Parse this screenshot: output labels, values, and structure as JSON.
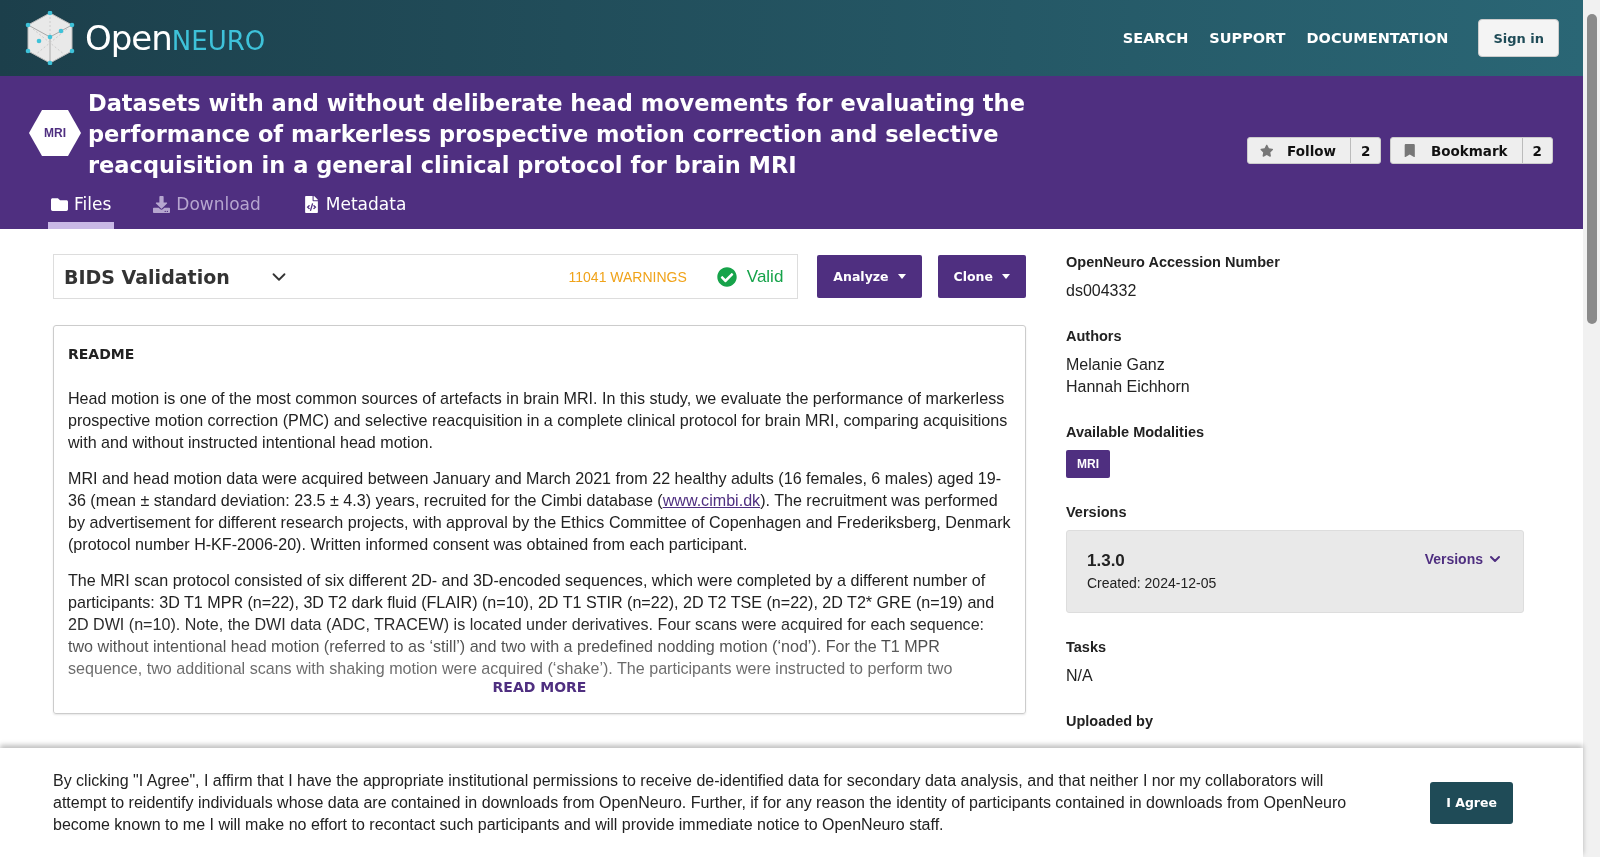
{
  "header": {
    "logo": {
      "open": "Open",
      "neuro": "NEURO"
    },
    "nav": [
      "SEARCH",
      "SUPPORT",
      "DOCUMENTATION"
    ],
    "sign_in": "Sign in"
  },
  "dataset": {
    "modality_badge": "MRI",
    "title": "Datasets with and without deliberate head movements for evaluating the performance of markerless prospective motion correction and selective reacquisition in a general clinical protocol for brain MRI",
    "actions": [
      {
        "kind": "follow",
        "label": "Follow",
        "count": "2"
      },
      {
        "kind": "bookmark",
        "label": "Bookmark",
        "count": "2"
      }
    ]
  },
  "tabs": [
    {
      "kind": "folder",
      "label": "Files",
      "selected": true,
      "disabled": false
    },
    {
      "kind": "download",
      "label": "Download",
      "selected": false,
      "disabled": true
    },
    {
      "kind": "file",
      "label": "Metadata",
      "selected": false,
      "disabled": false
    }
  ],
  "validation": {
    "title": "BIDS Validation",
    "warnings": "11041 WARNINGS",
    "status": "Valid"
  },
  "buttons": [
    "Analyze",
    "Clone"
  ],
  "readme": {
    "heading": "README",
    "paragraphs": [
      "Head motion is one of the most common sources of artefacts in brain MRI. In this study, we evaluate the performance of markerless prospective motion correction (PMC) and selective reacquisition in a complete clinical protocol for brain MRI, comparing acquisitions with and without instructed intentional head motion.",
      {
        "before": "MRI and head motion data were acquired between January and March 2021 from 22 healthy adults (16 females, 6 males) aged 19-36 (mean ± standard deviation: 23.5 ± 4.3) years, recruited for the Cimbi database (",
        "link": "www.cimbi.dk",
        "after": "). The recruitment was performed by advertisement for different research projects, with approval by the Ethics Committee of Copenhagen and Frederiksberg, Denmark (protocol number H-KF-2006-20). Written informed consent was obtained from each participant."
      },
      "The MRI scan protocol consisted of six different 2D- and 3D-encoded sequences, which were completed by a different number of participants: 3D T1 MPR (n=22), 3D T2 dark fluid (FLAIR) (n=10), 2D T1 STIR (n=22), 2D T2 TSE (n=22), 2D T2* GRE (n=19) and 2D DWI (n=10). Note, the DWI data (ADC, TRACEW) is located under derivatives. Four scans were acquired for each sequence: two without intentional head motion (referred to as ‘still’) and two with a predefined nodding motion (‘nod’). For the T1 MPR sequence, two additional scans with shaking motion were acquired (‘shake’). The participants were instructed to perform two"
    ],
    "read_more": "READ MORE"
  },
  "sidebar": [
    {
      "kind": "text",
      "label": "OpenNeuro Accession Number",
      "values": [
        "ds004332"
      ]
    },
    {
      "kind": "text",
      "label": "Authors",
      "values": [
        "Melanie Ganz",
        "Hannah Eichhorn"
      ]
    },
    {
      "kind": "badges",
      "label": "Available Modalities",
      "values": [
        "MRI"
      ]
    },
    {
      "kind": "version",
      "label": "Versions",
      "version": "1.3.0",
      "created": "Created: 2024-12-05",
      "toggle": "Versions"
    },
    {
      "kind": "text",
      "label": "Tasks",
      "values": [
        "N/A"
      ]
    },
    {
      "kind": "text",
      "label": "Uploaded by"
    }
  ],
  "consent": {
    "text": "By clicking \"I Agree\", I affirm that I have the appropriate institutional permissions to receive de-identified data for secondary data analysis, and that neither I nor my collaborators will attempt to reidentify individuals whose data are contained in downloads from OpenNeuro. Further, if for any reason the identity of participants contained in downloads from OpenNeuro become known to me I will make no effort to recontact such participants and will provide immediate notice to OpenNeuro staff.",
    "button": "I Agree"
  }
}
